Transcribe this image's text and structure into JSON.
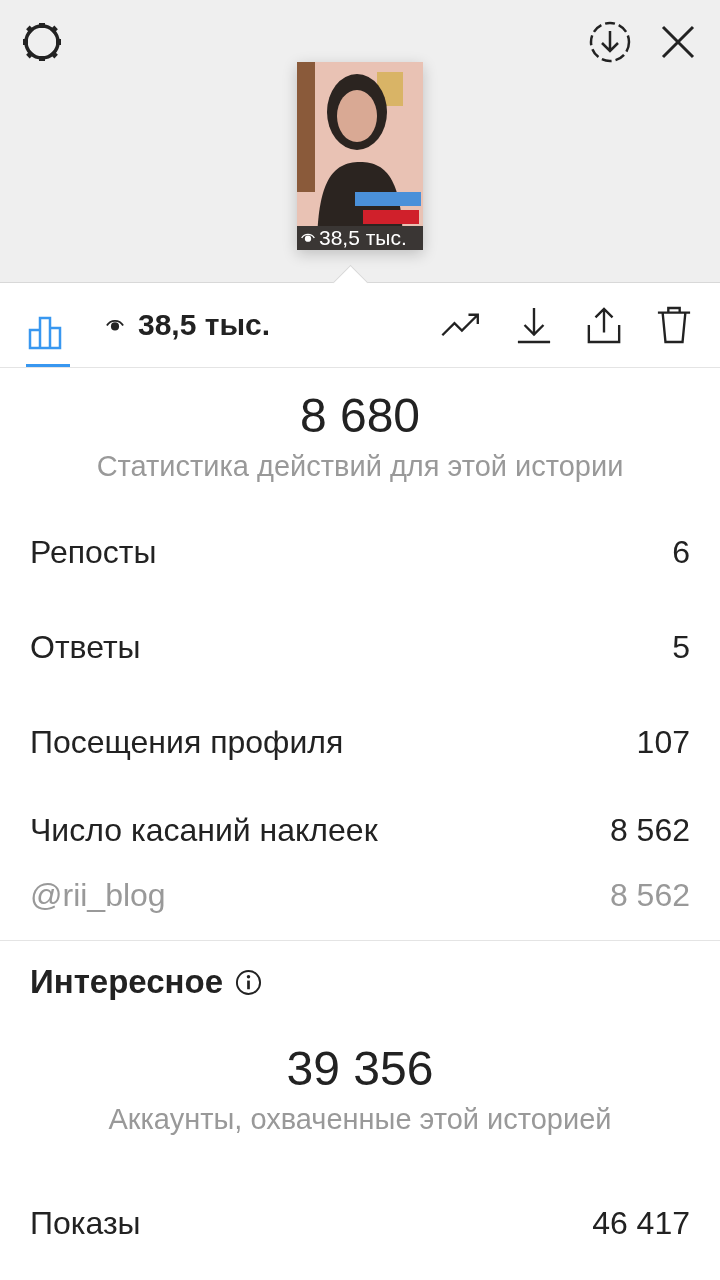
{
  "story": {
    "views": "38,5 тыс."
  },
  "toolbar": {
    "insights_tab": {
      "selected": true
    },
    "views": "38,5 тыс."
  },
  "actions": {
    "total": "8 680",
    "caption": "Статистика действий для этой истории",
    "rows": [
      {
        "label": "Репосты",
        "value": "6",
        "kind": "main"
      },
      {
        "label": "Ответы",
        "value": "5",
        "kind": "main"
      },
      {
        "label": "Посещения профиля",
        "value": "107",
        "kind": "main"
      },
      {
        "label": "Число касаний наклеек",
        "value": "8 562",
        "kind": "main"
      },
      {
        "label": "@rii_blog",
        "value": "8 562",
        "kind": "sub"
      }
    ]
  },
  "discovery": {
    "title": "Интересное",
    "total": "39 356",
    "caption": "Аккаунты, охваченные этой историей",
    "rows": [
      {
        "label": "Показы",
        "value": "46 417"
      }
    ]
  }
}
